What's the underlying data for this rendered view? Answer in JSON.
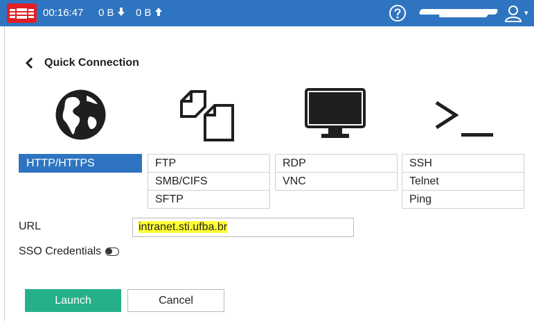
{
  "topbar": {
    "timer": "00:16:47",
    "received": "0 B",
    "sent": "0 B",
    "brand_color": "#e11f24",
    "bar_color": "#2f74c0"
  },
  "page": {
    "back_label": "Quick Connection"
  },
  "protocols": {
    "web": [
      "HTTP/HTTPS"
    ],
    "file": [
      "FTP",
      "SMB/CIFS",
      "SFTP"
    ],
    "desktop": [
      "RDP",
      "VNC"
    ],
    "terminal": [
      "SSH",
      "Telnet",
      "Ping"
    ],
    "selected": "HTTP/HTTPS"
  },
  "form": {
    "url_label": "URL",
    "url_value": "intranet.sti.ufba.br",
    "sso_label": "SSO Credentials"
  },
  "buttons": {
    "launch": "Launch",
    "cancel": "Cancel",
    "launch_color": "#26b08a"
  }
}
